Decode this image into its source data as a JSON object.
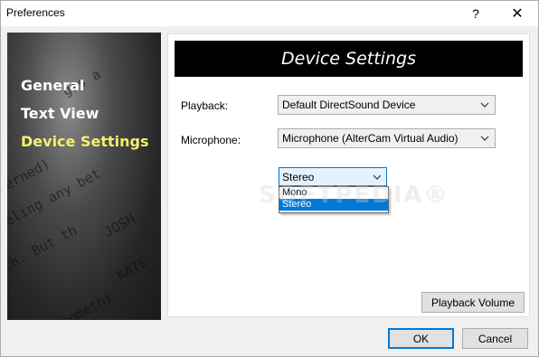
{
  "window": {
    "title": "Preferences",
    "help_glyph": "?",
    "close_glyph": "✕"
  },
  "sidebar": {
    "items": [
      {
        "label": "General",
        "active": false
      },
      {
        "label": "Text View",
        "active": false
      },
      {
        "label": "Device Settings",
        "active": true
      }
    ],
    "active_color": "#f4f070",
    "background_script": [
      "ges a",
      "ncerned)",
      "eeling any bet",
      "JOSH",
      "ch.  But th",
      "KATE",
      "n somethi"
    ]
  },
  "panel": {
    "banner_title": "Device Settings",
    "playback": {
      "label": "Playback:",
      "value": "Default DirectSound Device"
    },
    "microphone": {
      "label": "Microphone:",
      "value": "Microphone (AlterCam Virtual Audio)"
    },
    "channels": {
      "value": "Stereo",
      "options": [
        "Mono",
        "Stereo"
      ],
      "highlighted": "Stereo"
    },
    "playback_volume_label": "Playback Volume"
  },
  "buttons": {
    "ok": "OK",
    "cancel": "Cancel"
  },
  "watermark": "SOFTPEDIA®",
  "colors": {
    "accent": "#0078d7",
    "banner_bg": "#000000"
  }
}
